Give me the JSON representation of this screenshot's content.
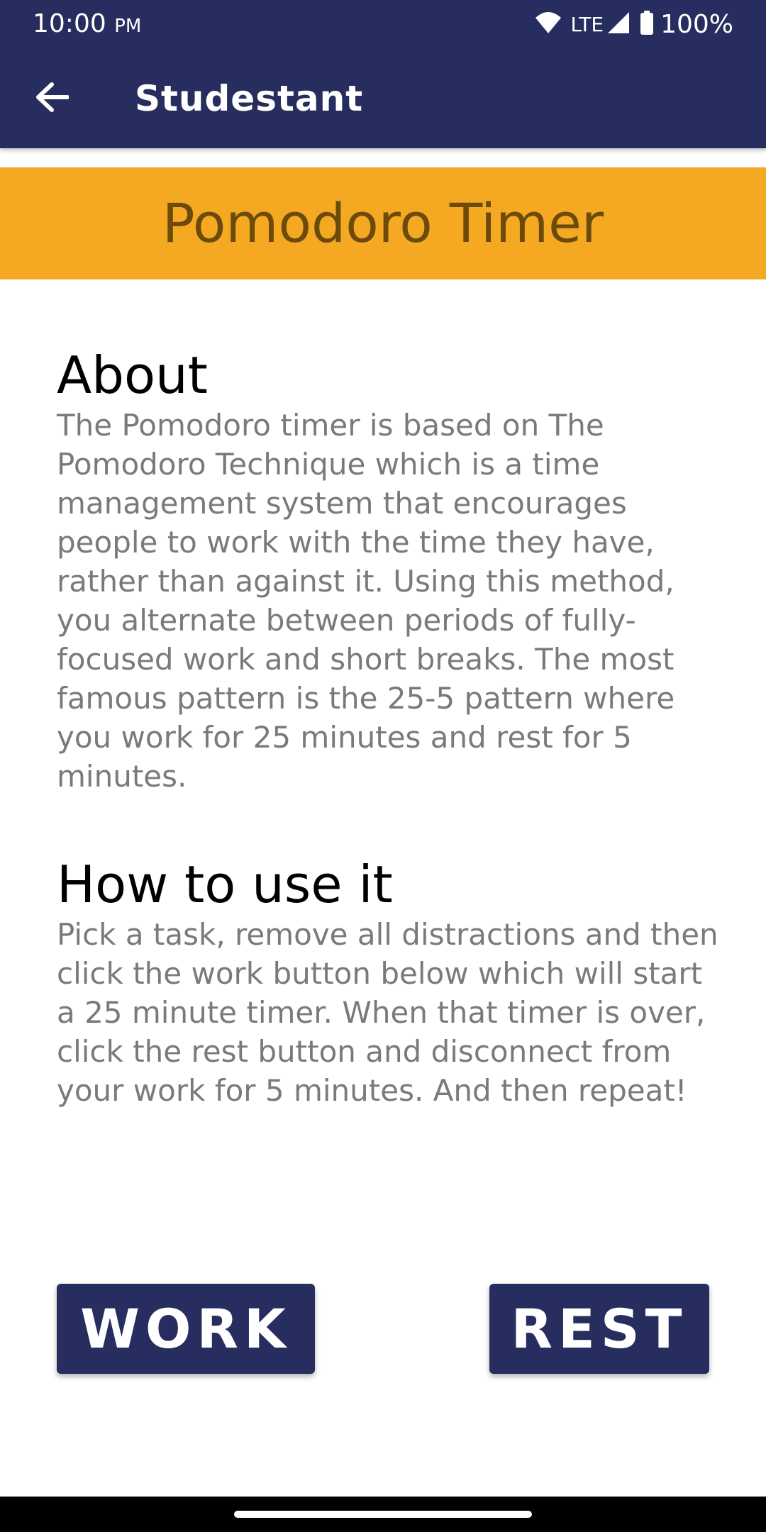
{
  "status_bar": {
    "time": "10:00",
    "ampm": "PM",
    "network": "LTE",
    "battery": "100%",
    "icons": [
      "wifi-icon",
      "signal-icon",
      "battery-icon"
    ]
  },
  "app_bar": {
    "title": "Studestant",
    "back_icon": "arrow-left-icon",
    "background_color": "#272d5e"
  },
  "banner": {
    "title": "Pomodoro Timer",
    "background_color": "#f5a922"
  },
  "about": {
    "heading": "About",
    "text": "The Pomodoro timer is based on The Pomodoro Technique which is a time management system that encourages people to work with the time they have, rather than against it. Using this method, you alternate between periods of fully-focused work and short breaks. The most famous pattern is the 25-5 pattern where you work for 25 minutes and rest for 5 minutes."
  },
  "how_to": {
    "heading": "How to use it",
    "text": "Pick a task, remove all distractions and then click the work button below which will start a 25 minute timer. When that timer is over, click the rest button and disconnect from your work for 5 minutes. And then repeat!"
  },
  "buttons": {
    "work_label": "WORK",
    "rest_label": "REST"
  }
}
